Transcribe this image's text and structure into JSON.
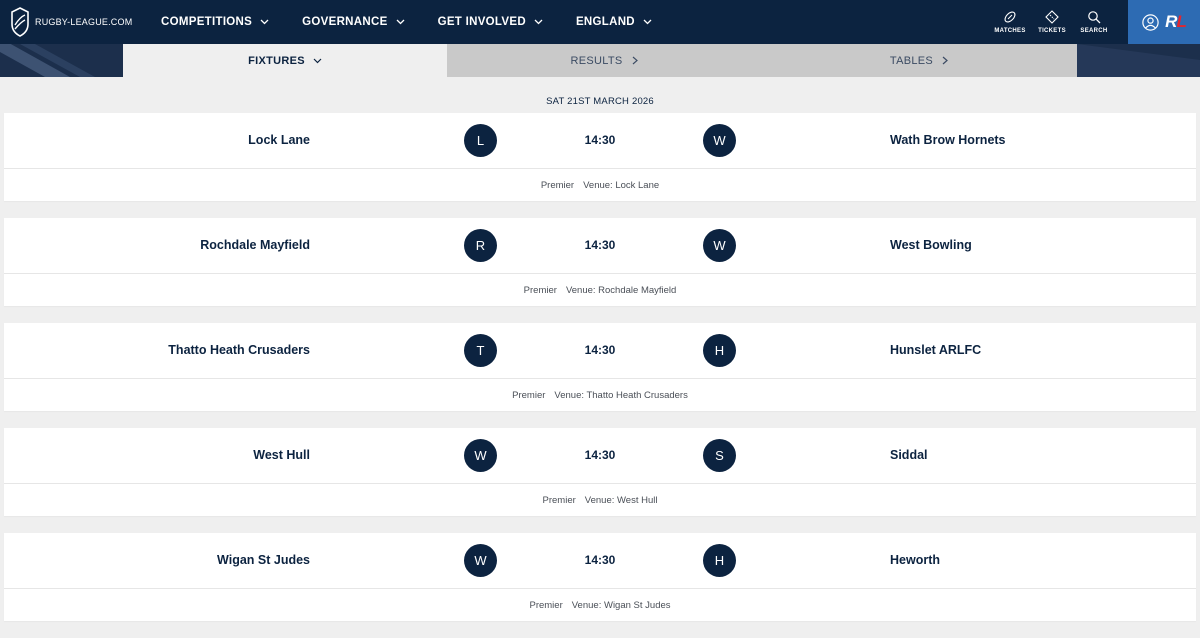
{
  "header": {
    "logo_text": "RUGBY-LEAGUE.COM",
    "nav": [
      {
        "label": "COMPETITIONS"
      },
      {
        "label": "GOVERNANCE"
      },
      {
        "label": "GET INVOLVED"
      },
      {
        "label": "ENGLAND"
      }
    ],
    "tools": [
      {
        "label": "MATCHES",
        "icon": "rugby-ball-icon"
      },
      {
        "label": "TICKETS",
        "icon": "ticket-icon"
      },
      {
        "label": "SEARCH",
        "icon": "search-icon"
      }
    ],
    "account_icon": "user-icon",
    "brand_logo": {
      "main": "R",
      "accent": "L"
    }
  },
  "tabs": [
    {
      "label": "FIXTURES",
      "active": true,
      "icon": "chevron-down-icon"
    },
    {
      "label": "RESULTS",
      "active": false,
      "icon": "chevron-right-icon"
    },
    {
      "label": "TABLES",
      "active": false,
      "icon": "chevron-right-icon"
    }
  ],
  "date_heading": "SAT 21ST MARCH 2026",
  "fixtures": [
    {
      "home": "Lock Lane",
      "home_initial": "L",
      "time": "14:30",
      "away": "Wath Brow Hornets",
      "away_initial": "W",
      "competition": "Premier",
      "venue": "Venue: Lock Lane"
    },
    {
      "home": "Rochdale Mayfield",
      "home_initial": "R",
      "time": "14:30",
      "away": "West Bowling",
      "away_initial": "W",
      "competition": "Premier",
      "venue": "Venue: Rochdale Mayfield"
    },
    {
      "home": "Thatto Heath Crusaders",
      "home_initial": "T",
      "time": "14:30",
      "away": "Hunslet ARLFC",
      "away_initial": "H",
      "competition": "Premier",
      "venue": "Venue: Thatto Heath Crusaders"
    },
    {
      "home": "West Hull",
      "home_initial": "W",
      "time": "14:30",
      "away": "Siddal",
      "away_initial": "S",
      "competition": "Premier",
      "venue": "Venue: West Hull"
    },
    {
      "home": "Wigan St Judes",
      "home_initial": "W",
      "time": "14:30",
      "away": "Heworth",
      "away_initial": "H",
      "competition": "Premier",
      "venue": "Venue: Wigan St Judes"
    }
  ],
  "colors": {
    "navy": "#0c2340",
    "accent_blue": "#2d6bb3",
    "brand_red": "#e3262f",
    "page_bg": "#efefef"
  }
}
